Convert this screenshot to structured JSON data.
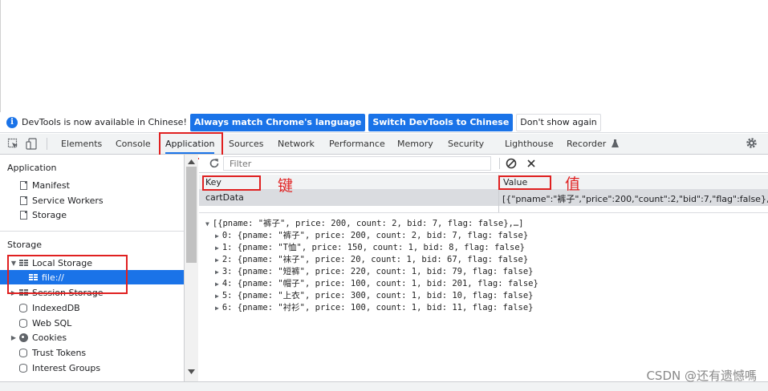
{
  "infobar": {
    "message": "DevTools is now available in Chinese!",
    "btn_match": "Always match Chrome's language",
    "btn_switch": "Switch DevTools to Chinese",
    "btn_dismiss": "Don't show again"
  },
  "tabs": {
    "elements": "Elements",
    "console": "Console",
    "application": "Application",
    "sources": "Sources",
    "network": "Network",
    "performance": "Performance",
    "memory": "Memory",
    "security": "Security",
    "lighthouse": "Lighthouse",
    "recorder": "Recorder"
  },
  "sidebar": {
    "app_section": "Application",
    "manifest": "Manifest",
    "service_workers": "Service Workers",
    "storage_item": "Storage",
    "storage_section": "Storage",
    "local_storage": "Local Storage",
    "file_origin": "file://",
    "session_storage": "Session Storage",
    "indexeddb": "IndexedDB",
    "websql": "Web SQL",
    "cookies": "Cookies",
    "trust_tokens": "Trust Tokens",
    "interest_groups": "Interest Groups"
  },
  "filter": {
    "placeholder": "Filter"
  },
  "table": {
    "key_header": "Key",
    "value_header": "Value",
    "row_key": "cartData",
    "row_value": "[{\"pname\":\"裤子\",\"price\":200,\"count\":2,\"bid\":7,\"flag\":false},{\"pname\""
  },
  "annotations": {
    "key": "键",
    "value": "值"
  },
  "preview": {
    "summary": "[{pname: \"裤子\", price: 200, count: 2, bid: 7, flag: false},…]",
    "items": [
      "0: {pname: \"裤子\", price: 200, count: 2, bid: 7, flag: false}",
      "1: {pname: \"T恤\", price: 150, count: 1, bid: 8, flag: false}",
      "2: {pname: \"袜子\", price: 20, count: 1, bid: 67, flag: false}",
      "3: {pname: \"短裤\", price: 220, count: 1, bid: 79, flag: false}",
      "4: {pname: \"帽子\", price: 100, count: 1, bid: 201, flag: false}",
      "5: {pname: \"上衣\", price: 300, count: 1, bid: 10, flag: false}",
      "6: {pname: \"衬衫\", price: 100, count: 1, bid: 11, flag: false}"
    ]
  },
  "watermark": "CSDN @还有遗憾嗎",
  "colors": {
    "accent": "#1a73e8",
    "highlight": "#e02020"
  },
  "icons": [
    "info-icon",
    "inspect-icon",
    "device-icon",
    "refresh-icon",
    "clear-icon",
    "delete-icon",
    "settings-icon",
    "flask-icon"
  ]
}
